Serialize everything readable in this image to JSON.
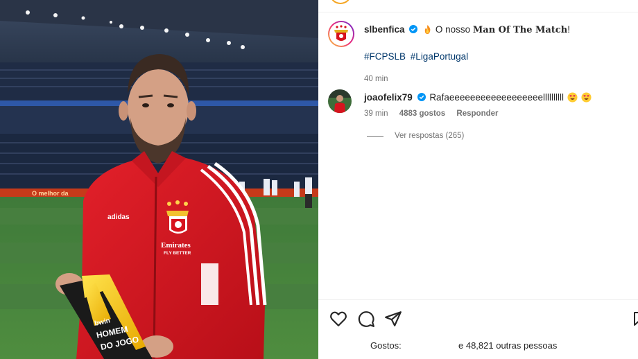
{
  "post": {
    "account": "slbenfica",
    "caption_prefix": "O nosso",
    "caption_bold": "Man Of The Match",
    "caption_suffix": "!",
    "hashtags": [
      "#FCPSLB",
      "#LigaPortugal"
    ],
    "time": "40 min"
  },
  "comment": {
    "user": "joaofelix79",
    "text": "Rafaeeeeeeeeeeeeeeeeeellllllllll",
    "time": "39 min",
    "likes": "4883 gostos",
    "reply_label": "Responder"
  },
  "view_replies": "Ver respostas (265)",
  "likes_bar": {
    "label": "Gostos:",
    "others": "e 48,821 outras pessoas"
  },
  "photo": {
    "shirt_sponsor": "Emirates",
    "shirt_sponsor_sub": "FLY BETTER",
    "shirt_brand": "adidas",
    "trophy_brand": "bwin",
    "trophy_text_1": "HOMEM",
    "trophy_text_2": "DO JOGO",
    "board_text": "O melhor da"
  },
  "icons": {
    "verified": "verified-badge-icon",
    "like": "heart-icon",
    "comment": "comment-bubble-icon",
    "share": "paper-plane-icon",
    "save": "bookmark-icon",
    "fire": "fire-emoji-icon",
    "heart_eyes": "heart-eyes-emoji-icon"
  },
  "colors": {
    "benfica_red": "#d7141e",
    "verified_blue": "#0095f6",
    "hashtag_blue": "#00376b",
    "meta_gray": "#737373"
  }
}
